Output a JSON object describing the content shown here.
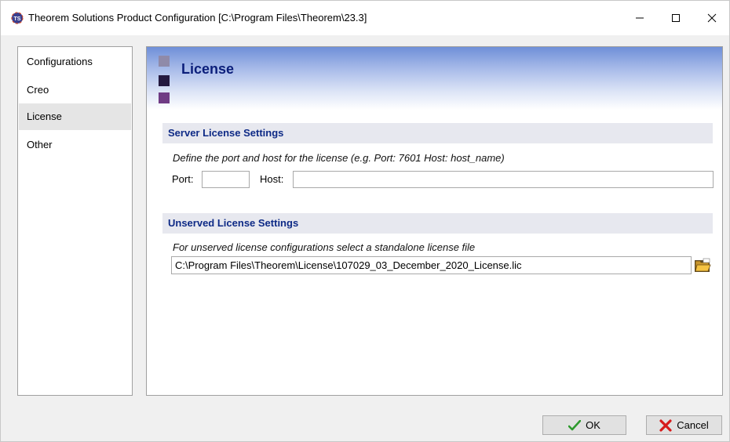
{
  "window": {
    "title": "Theorem Solutions Product Configuration [C:\\Program Files\\Theorem\\23.3]"
  },
  "sidebar": {
    "items": [
      {
        "label": "Configurations"
      },
      {
        "label": "Creo"
      },
      {
        "label": "License"
      },
      {
        "label": "Other"
      }
    ],
    "selected": "License"
  },
  "page": {
    "title": "License"
  },
  "server_section": {
    "heading": "Server License Settings",
    "description": "Define the port and host for the license (e.g. Port: 7601  Host: host_name)",
    "port_label": "Port:",
    "port_value": "",
    "host_label": "Host:",
    "host_value": ""
  },
  "unserved_section": {
    "heading": "Unserved License Settings",
    "description": "For unserved license configurations select a standalone license file",
    "file_path": "C:\\Program Files\\Theorem\\License\\107029_03_December_2020_License.lic"
  },
  "buttons": {
    "ok_label": "OK",
    "cancel_label": "Cancel"
  },
  "colors": {
    "heading_text": "#0e2a86",
    "title_text": "#0b1e7a",
    "section_bg": "#e7e8ef",
    "band_top": "#6f8fd8",
    "selected_nav_bg": "#e5e5e5"
  },
  "icons": {
    "app": "theorem-logo-icon",
    "minimize": "minimize-icon",
    "maximize": "maximize-icon",
    "close": "close-icon",
    "browse": "folder-open-icon",
    "ok": "checkmark-icon",
    "cancel": "x-icon"
  }
}
